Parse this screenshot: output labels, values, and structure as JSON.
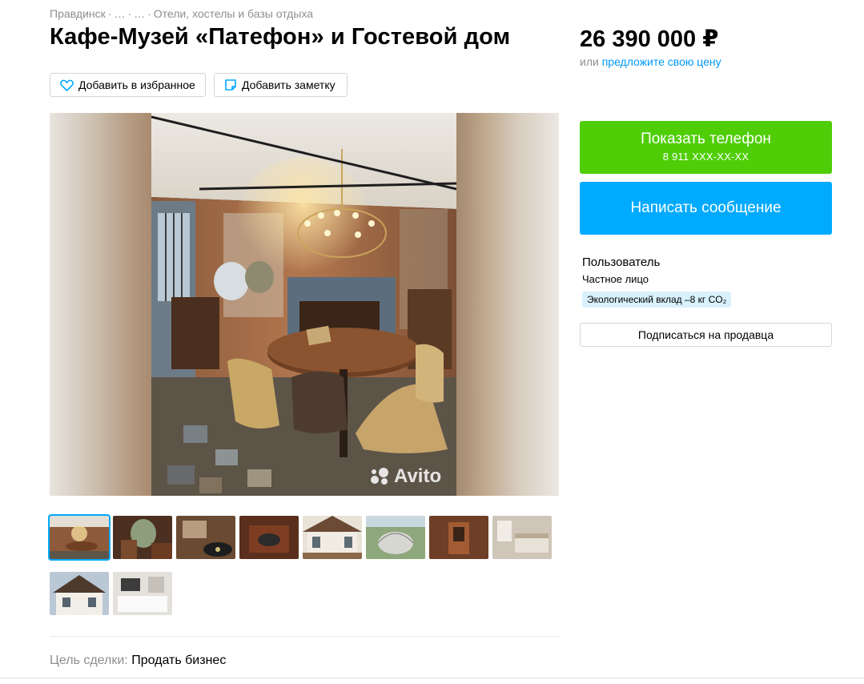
{
  "breadcrumb": {
    "items": [
      "Правдинск",
      "…",
      "…",
      "Отели, хостелы и базы отдыха"
    ],
    "separator": "·"
  },
  "title": "Кафе-Музей «Патефон» и Гостевой дом",
  "price": {
    "value": "26 390 000 ₽",
    "offer_prefix": "или",
    "offer_link": "предложите свою цену"
  },
  "actions": {
    "favorite_label": "Добавить в избранное",
    "note_label": "Добавить заметку",
    "favorite_icon": "heart-icon",
    "note_icon": "note-icon"
  },
  "gallery": {
    "watermark": "Avito",
    "thumbnail_count": 10,
    "active_thumbnail": 1
  },
  "contact": {
    "phone_button": "Показать телефон",
    "phone_masked": "8 911 XXX-XX-XX",
    "message_button": "Написать сообщение"
  },
  "seller": {
    "name": "Пользователь",
    "type": "Частное лицо",
    "eco_badge": "Экологический вклад –8 кг CO₂",
    "subscribe_button": "Подписаться на продавца"
  },
  "deal": {
    "label": "Цель сделки:",
    "value": "Продать бизнес"
  },
  "colors": {
    "accent_green": "#4fce07",
    "accent_blue": "#00aaff",
    "link_blue": "#0099f7",
    "eco_bg": "#d8f1fd"
  }
}
